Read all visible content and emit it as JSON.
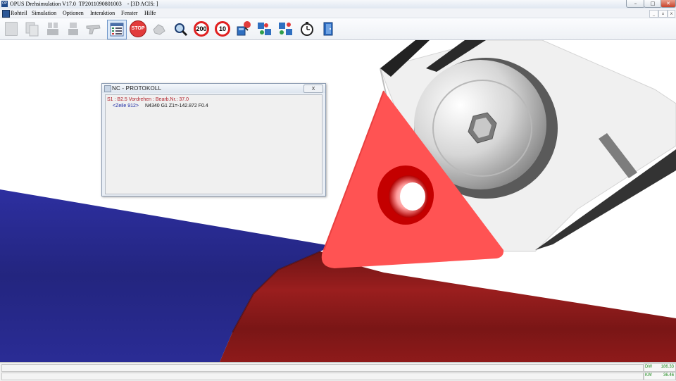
{
  "window": {
    "title": "OPUS Drehsimulation V17.0  TP2011090801003    - [3D ACIS: ]",
    "icon_label": "OP",
    "controls": {
      "minimize": "–",
      "maximize": "□",
      "close": "✕"
    }
  },
  "menu": {
    "items": [
      "Rohteil",
      "Simulation",
      "Optionen",
      "Interaktion",
      "Fenster",
      "Hilfe"
    ],
    "mdi_controls": {
      "minimize": "_",
      "restore": "▫",
      "close": "x"
    }
  },
  "toolbar": {
    "buttons": [
      {
        "icon": "new-document-icon",
        "label": ""
      },
      {
        "icon": "copy-document-icon",
        "label": ""
      },
      {
        "icon": "part-stack-icon",
        "label": ""
      },
      {
        "icon": "part-single-icon",
        "label": ""
      },
      {
        "icon": "pistol-icon",
        "label": ""
      },
      {
        "icon": "nc-list-icon",
        "label": ""
      },
      {
        "icon": "stop-icon",
        "label": "STOP"
      },
      {
        "icon": "hand-tool-icon",
        "label": ""
      },
      {
        "icon": "magnifier-icon",
        "label": ""
      },
      {
        "icon": "speed-limit-icon",
        "label": "200"
      },
      {
        "icon": "speed-limit-icon",
        "label": "10"
      },
      {
        "icon": "tool-change-icon",
        "label": ""
      },
      {
        "icon": "tool-compare-icon",
        "label": ""
      },
      {
        "icon": "tool-swap-icon",
        "label": ""
      },
      {
        "icon": "stopwatch-icon",
        "label": ""
      },
      {
        "icon": "exit-door-icon",
        "label": ""
      }
    ]
  },
  "nc_protocol": {
    "title": "NC - PROTOKOLL",
    "close_label": "X",
    "line1": "S1 : B2.5 Vordrehen : Bearb.Nr.: 37.0",
    "line2_ref": "<Zeile 912>",
    "line2_code": "N4340 G1 Z1=-142.872 F0.4"
  },
  "status": {
    "readouts": [
      {
        "label": "DW",
        "value": "186.33"
      },
      {
        "label": "KW",
        "value": "36.46"
      }
    ]
  },
  "colors": {
    "workpiece_red": "#8e1a1a",
    "chuck_blue": "#26288e",
    "insert_red": "#ff5050",
    "accent_title": "#1f4a8a"
  }
}
